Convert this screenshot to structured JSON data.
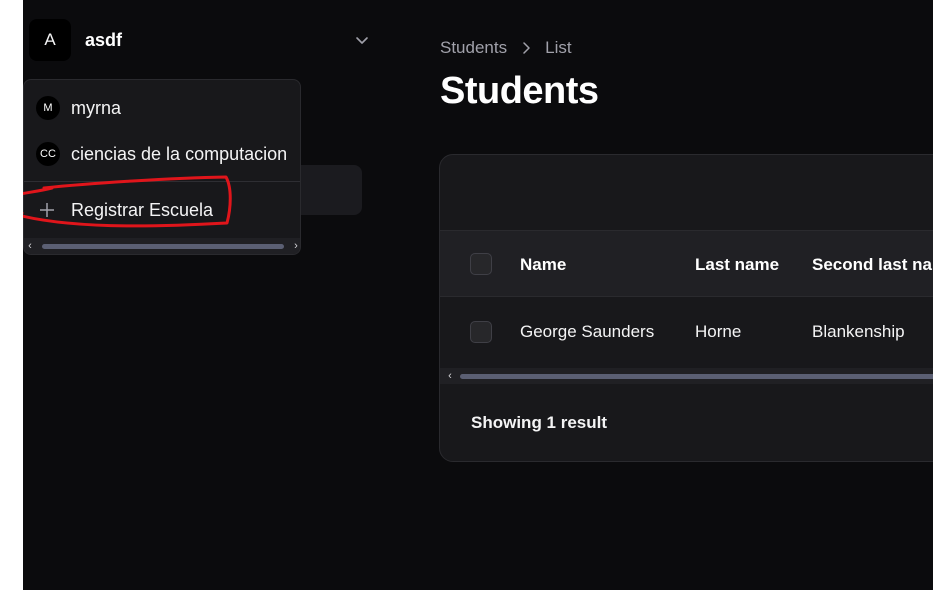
{
  "tenant": {
    "initial": "A",
    "name": "asdf"
  },
  "dropdown": {
    "items": [
      {
        "badge": "M",
        "label": "myrna"
      },
      {
        "badge": "CC",
        "label": "ciencias de la computacion"
      }
    ],
    "register_label": "Registrar Escuela"
  },
  "breadcrumb": {
    "parent": "Students",
    "current": "List"
  },
  "page": {
    "title": "Students"
  },
  "table": {
    "columns": [
      "Name",
      "Last name",
      "Second last na"
    ],
    "rows": [
      {
        "name": "George Saunders",
        "last_name": "Horne",
        "second_last_name": "Blankenship"
      }
    ],
    "footer": "Showing 1 result"
  },
  "colors": {
    "background": "#0b0b0d",
    "card": "#18181b",
    "annotation": "#e0151b"
  },
  "icons": {
    "chevron": "chevron-down-icon",
    "separator": "chevron-right-icon",
    "plus": "plus-icon"
  }
}
